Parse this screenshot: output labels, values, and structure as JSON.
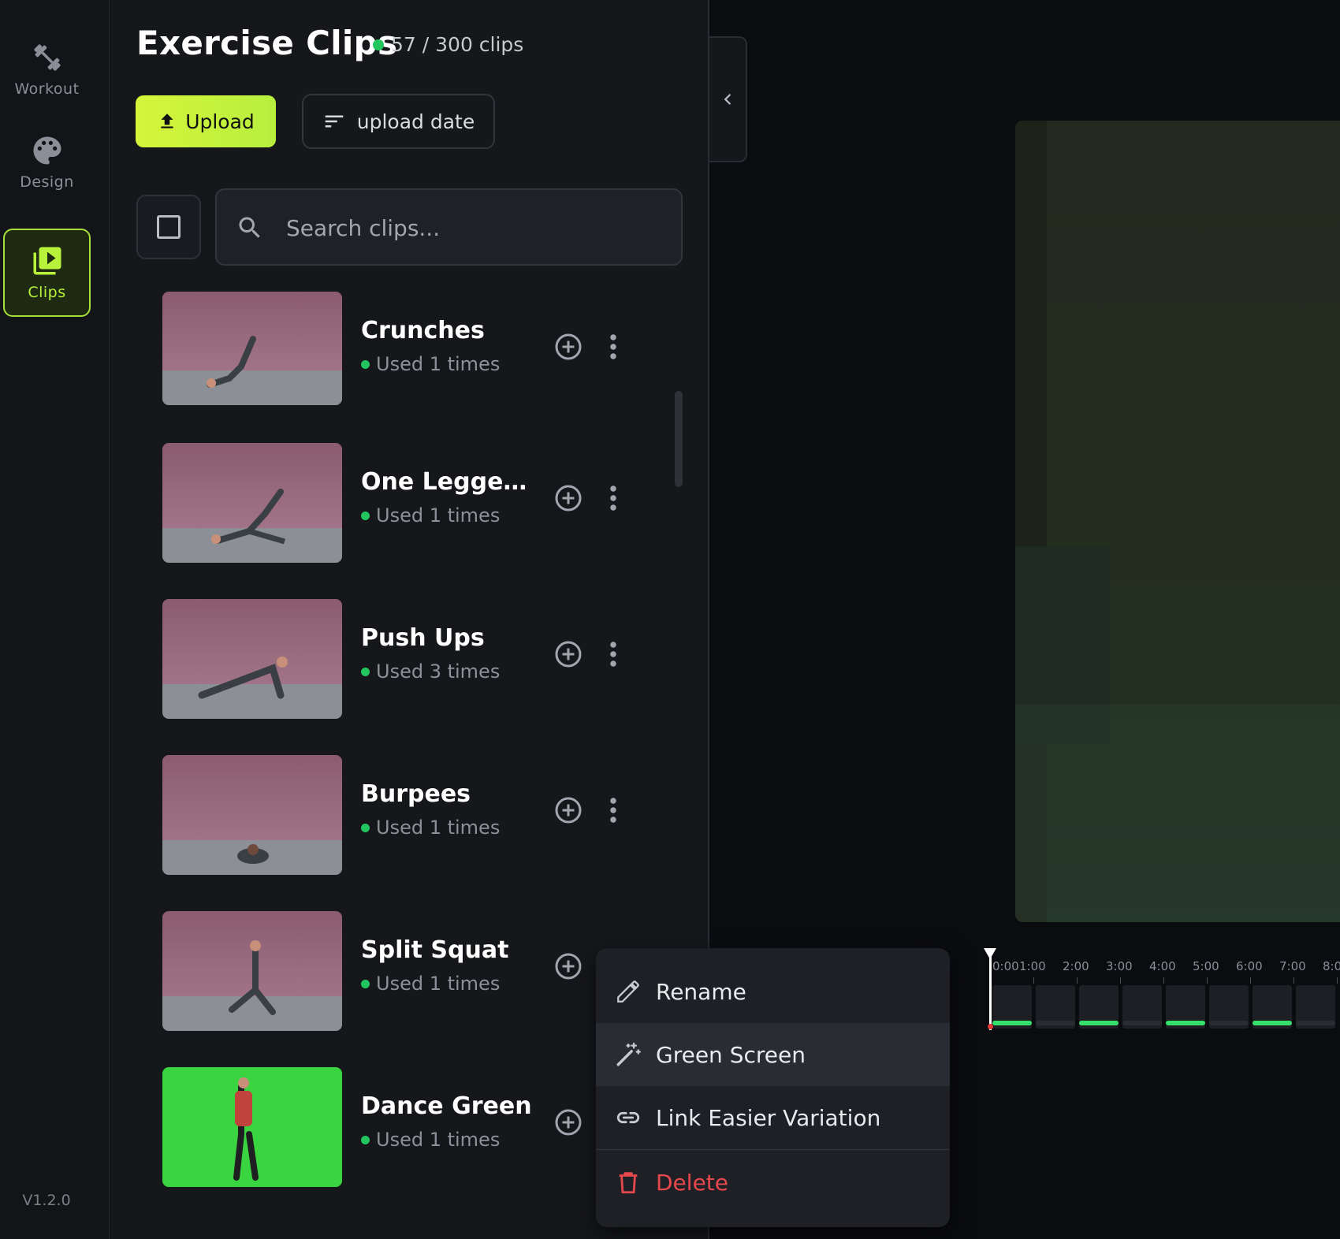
{
  "rail": {
    "items": [
      {
        "label": "Workout",
        "icon": "dumbbell-icon"
      },
      {
        "label": "Design",
        "icon": "palette-icon"
      },
      {
        "label": "Clips",
        "icon": "video-library-icon"
      }
    ],
    "active": "Clips",
    "version": "V1.2.0"
  },
  "panel": {
    "title": "Exercise Clips",
    "count": "57 / 300 clips",
    "upload_label": "Upload",
    "sort_label": "upload date",
    "search_placeholder": "Search clips..."
  },
  "clips": [
    {
      "name": "Crunches",
      "used": "Used 1 times",
      "thumb": "pink"
    },
    {
      "name": "One Legged B...",
      "used": "Used 1 times",
      "thumb": "pink"
    },
    {
      "name": "Push Ups",
      "used": "Used 3 times",
      "thumb": "pink"
    },
    {
      "name": "Burpees",
      "used": "Used 1 times",
      "thumb": "pink"
    },
    {
      "name": "Split Squat",
      "used": "Used 1 times",
      "thumb": "pink"
    },
    {
      "name": "Dance Green",
      "used": "Used 1 times",
      "thumb": "green"
    }
  ],
  "timeline": {
    "labels": [
      "0:00",
      "1:00",
      "2:00",
      "3:00",
      "4:00",
      "5:00",
      "6:00",
      "7:00",
      "8:0"
    ]
  },
  "context_menu": {
    "items": [
      {
        "label": "Rename",
        "icon": "pencil-icon"
      },
      {
        "label": "Green Screen",
        "icon": "magic-wand-icon"
      },
      {
        "label": "Link Easier Variation",
        "icon": "link-icon"
      },
      {
        "label": "Delete",
        "icon": "trash-icon"
      }
    ],
    "highlighted": "Green Screen"
  },
  "colors": {
    "accent": "#b8f23b",
    "status_green": "#22c55e",
    "danger": "#e5484d",
    "timeline_active": "#35e06a"
  }
}
